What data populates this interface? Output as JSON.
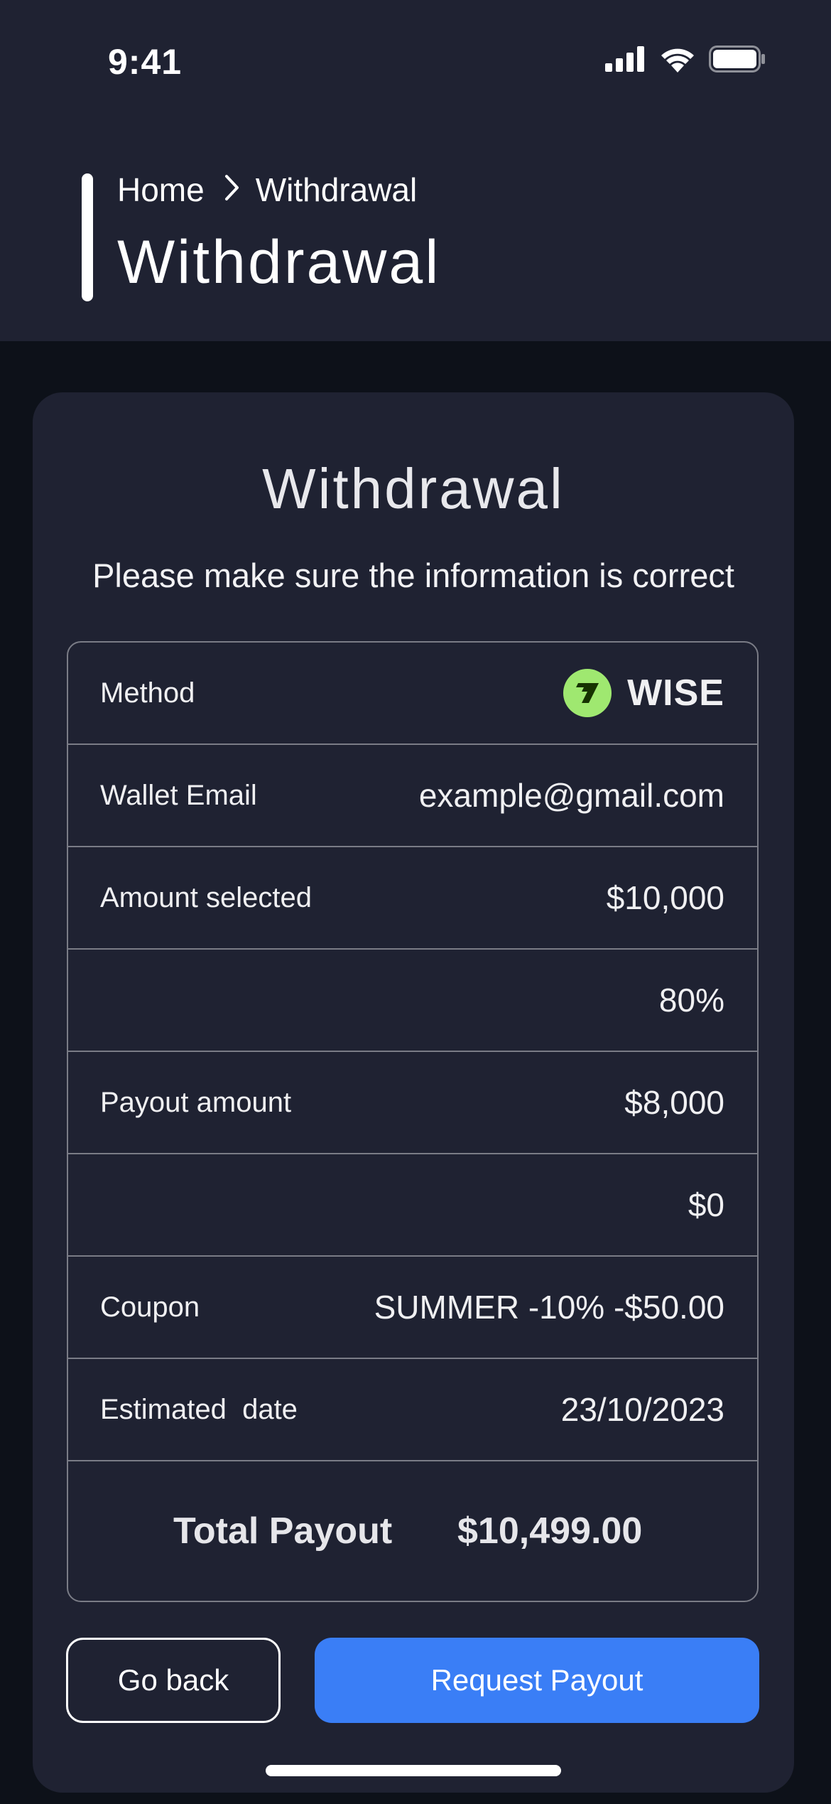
{
  "status_bar": {
    "time": "9:41",
    "icons": [
      "signal-icon",
      "wifi-icon",
      "battery-icon"
    ]
  },
  "header": {
    "breadcrumb": {
      "home": "Home",
      "current": "Withdrawal"
    },
    "title": "Withdrawal"
  },
  "card": {
    "title": "Withdrawal",
    "subtitle": "Please make sure the information is correct",
    "rows": {
      "method": {
        "label": "Method",
        "value": "WISE",
        "icon": "wise-logo-icon"
      },
      "wallet_email": {
        "label": "Wallet Email",
        "value": "example@gmail.com"
      },
      "amount_selected": {
        "label": "Amount selected",
        "value": "$10,000"
      },
      "percent": {
        "label": "",
        "value": "80%"
      },
      "payout_amount": {
        "label": "Payout amount",
        "value": "$8,000"
      },
      "fee": {
        "label": "",
        "value": "$0"
      },
      "coupon": {
        "label": "Coupon",
        "value": "SUMMER -10% -$50.00"
      },
      "estimated_date": {
        "label": "Estimated  date",
        "value": "23/10/2023"
      }
    },
    "total": {
      "label": "Total Payout",
      "value": "$10,499.00"
    }
  },
  "actions": {
    "back_label": "Go back",
    "request_label": "Request Payout"
  },
  "colors": {
    "background": "#0d1119",
    "surface": "#1f2232",
    "border": "#7a7c86",
    "accent": "#3a7ef6",
    "wise_green": "#9fe870"
  }
}
